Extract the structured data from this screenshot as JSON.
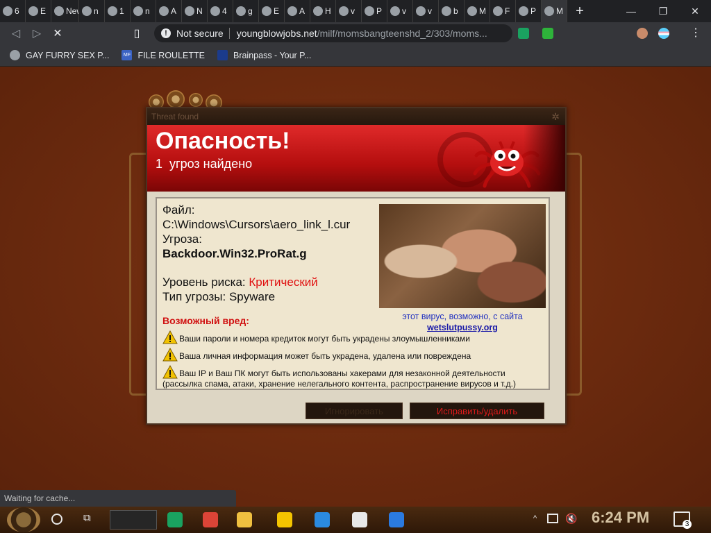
{
  "tabs": [
    {
      "label": "6",
      "icon": "folder-icon"
    },
    {
      "label": "E",
      "icon": "wolf-icon"
    },
    {
      "label": "New",
      "icon": "new-tab-icon"
    },
    {
      "label": "n",
      "icon": "globe-icon"
    },
    {
      "label": "1",
      "icon": "pixel-art-icon"
    },
    {
      "label": "n",
      "icon": "globe-icon"
    },
    {
      "label": "A",
      "icon": "lips-icon"
    },
    {
      "label": "N",
      "icon": "globe-icon"
    },
    {
      "label": "4",
      "icon": "globe-icon"
    },
    {
      "label": "g",
      "icon": "globe-icon"
    },
    {
      "label": "E",
      "icon": "windows-icon"
    },
    {
      "label": "A",
      "icon": "mf-icon"
    },
    {
      "label": "H",
      "icon": "hd-icon"
    },
    {
      "label": "v",
      "icon": "globe-icon"
    },
    {
      "label": "P",
      "icon": "face-icon"
    },
    {
      "label": "v",
      "icon": "psn-icon"
    },
    {
      "label": "v",
      "icon": "globe-icon"
    },
    {
      "label": "b",
      "icon": "globe-icon"
    },
    {
      "label": "M",
      "icon": "globe-icon"
    },
    {
      "label": "F",
      "icon": "firefox-icon"
    },
    {
      "label": "P",
      "icon": "dragon-icon"
    },
    {
      "label": "M",
      "icon": "generic-icon",
      "active": true
    }
  ],
  "toolbar": {
    "not_secure": "Not secure",
    "url_host": "youngblowjobs.net",
    "url_path": "/milf/momsbangteenshd_2/303/moms..."
  },
  "bookmarks": [
    {
      "label": "GAY FURRY SEX P...",
      "icon": "globe-icon"
    },
    {
      "label": "FILE ROULETTE",
      "icon": "mf-icon"
    },
    {
      "label": "Brainpass - Your P...",
      "icon": "psn-icon"
    }
  ],
  "dialog": {
    "title": "Threat found",
    "heading": "Опасность!",
    "count_number": "1",
    "count_text": "угроз найдено",
    "file_label": "Файл:",
    "file_path": "C:\\Windows\\Cursors\\aero_link_l.cur",
    "threat_label": "Угроза:",
    "threat_name": "Backdoor.Win32.ProRat.g",
    "risk_label": "Уровень риска:",
    "risk_value": "Критический",
    "type_label": "Тип угрозы:",
    "type_value": "Spyware",
    "source_caption": "этот вирус, возможно, с сайта",
    "source_link": "wetslutpussy.org",
    "harm_heading": "Возможный вред:",
    "harm_items": [
      "Ваши пароли и номера кредиток могут быть украдены злоумышленниками",
      "Ваша личная информация может быть украдена, удалена или повреждена",
      "Ваш IP и Ваш ПК могут быть использованы хакерами для незаконной деятельности"
    ],
    "harm_item_3_cont": "(рассылка спама, атаки, хранение нелегального контента, распространение вирусов и т.д.)",
    "ignore_button": "Игнорировать",
    "fix_button": "Исправить/удалить",
    "colors": {
      "danger": "#e01010",
      "header": "#c01414",
      "link": "#1a1aa8"
    }
  },
  "status": "Waiting for cache...",
  "taskbar": {
    "apps": [
      {
        "name": "notepad-app",
        "color": "#1aa260"
      },
      {
        "name": "chrome-app",
        "color": "#db4437"
      },
      {
        "name": "file-explorer-app",
        "color": "#f0c040"
      },
      {
        "name": "sticky-notes-app",
        "color": "#f5c400"
      },
      {
        "name": "onedrive-app",
        "color": "#2b8ae0"
      },
      {
        "name": "7zip-app",
        "color": "#e8e8e8"
      },
      {
        "name": "health-app",
        "color": "#2b7ae0"
      }
    ],
    "clock": "6:24 PM",
    "notification_count": "3"
  }
}
